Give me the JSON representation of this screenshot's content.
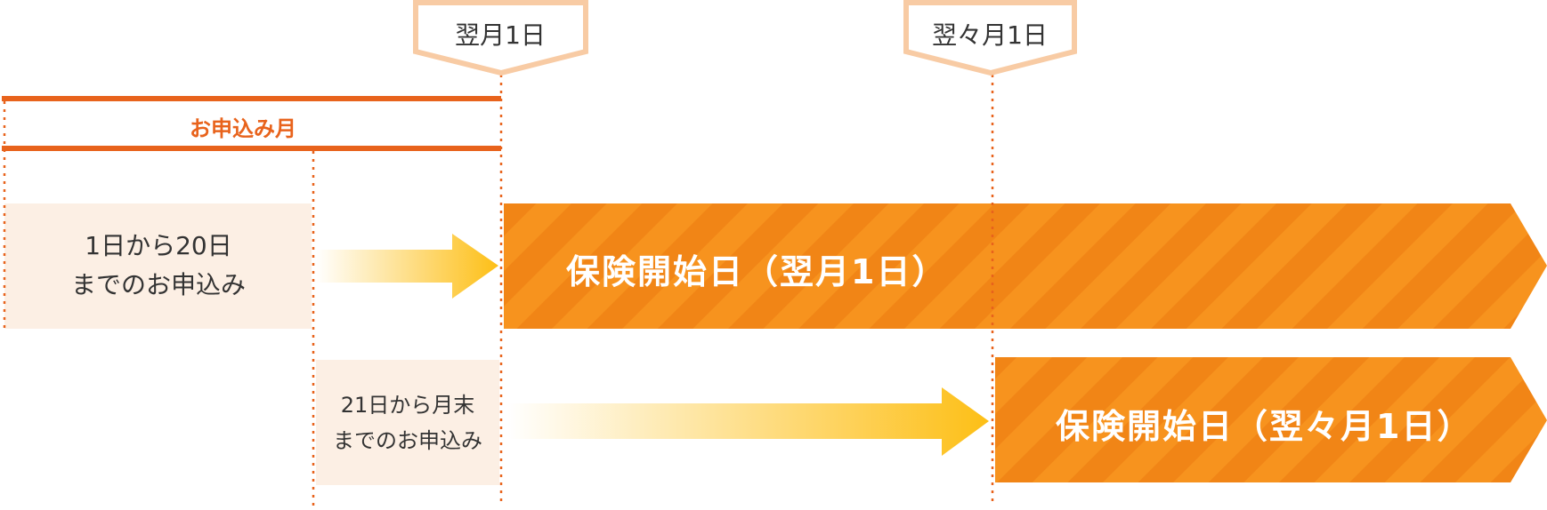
{
  "colors": {
    "accent": "#e8631c",
    "band": "#f7931e",
    "band_stripe": "#f18516",
    "tag_border": "#f8cba4",
    "box_fill": "#fcefe4",
    "arrow_head": "#fdbf16"
  },
  "markers": {
    "next_month_first": "翌月1日",
    "month_after_next_first": "翌々月1日"
  },
  "application_month": {
    "label": "お申込み月"
  },
  "cases": [
    {
      "period_lines": [
        "1日から20日",
        "までのお申込み"
      ],
      "start_label": "保険開始日（翌月1日）"
    },
    {
      "period_lines": [
        "21日から月末",
        "までのお申込み"
      ],
      "start_label": "保険開始日（翌々月1日）"
    }
  ]
}
